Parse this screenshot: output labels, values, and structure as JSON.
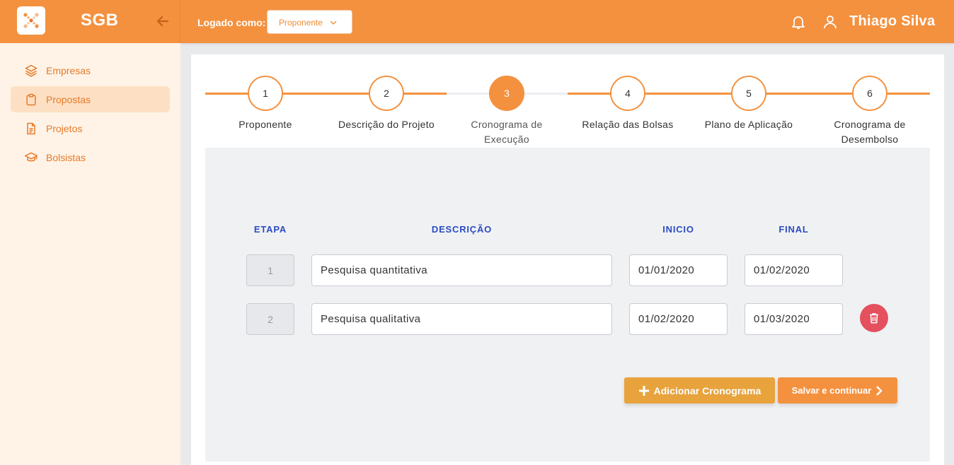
{
  "app": {
    "name": "SGB"
  },
  "topbar": {
    "logged_label": "Logado como:",
    "role_value": "Proponente",
    "user_name": "Thiago Silva"
  },
  "sidebar": {
    "items": [
      {
        "label": "Empresas",
        "icon": "layers-icon",
        "active": false
      },
      {
        "label": "Propostas",
        "icon": "clipboard-icon",
        "active": true
      },
      {
        "label": "Projetos",
        "icon": "document-icon",
        "active": false
      },
      {
        "label": "Bolsistas",
        "icon": "graduation-cap-icon",
        "active": false
      }
    ]
  },
  "stepper": {
    "current": 3,
    "steps": [
      {
        "number": "1",
        "label": "Proponente"
      },
      {
        "number": "2",
        "label": "Descrição do Projeto"
      },
      {
        "number": "3",
        "label": "Cronograma de Execução"
      },
      {
        "number": "4",
        "label": "Relação das Bolsas"
      },
      {
        "number": "5",
        "label": "Plano de Aplicação"
      },
      {
        "number": "6",
        "label": "Cronograma de Desembolso"
      }
    ]
  },
  "table": {
    "headers": {
      "etapa": "ETAPA",
      "descricao": "DESCRIÇÃO",
      "inicio": "INICIO",
      "final": "FINAL"
    },
    "rows": [
      {
        "etapa": "1",
        "descricao": "Pesquisa quantitativa",
        "inicio": "01/01/2020",
        "final": "01/02/2020"
      },
      {
        "etapa": "2",
        "descricao": "Pesquisa qualitativa",
        "inicio": "01/02/2020",
        "final": "01/03/2020"
      }
    ]
  },
  "actions": {
    "add_label": "Adicionar Cronograma",
    "save_label": "Salvar e continuar"
  },
  "colors": {
    "primary": "#f4913f",
    "sidebar_bg": "#fef3e6",
    "accent_blue": "#2a4cc2",
    "danger": "#e4505e",
    "add_button": "#e8a33c"
  }
}
